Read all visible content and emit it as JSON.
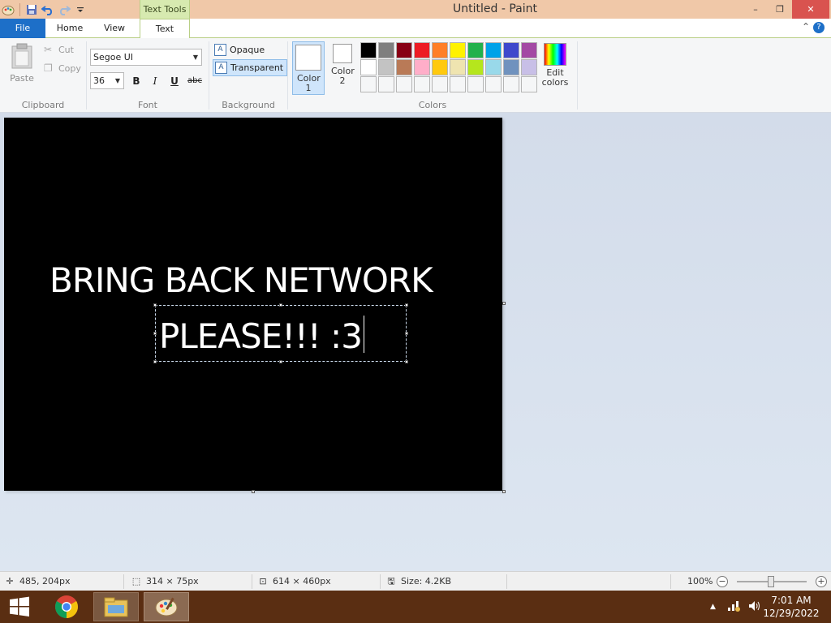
{
  "window": {
    "title": "Untitled - Paint",
    "context_tab": "Text Tools",
    "controls": {
      "minimize": "–",
      "restore": "❐",
      "close": "✕"
    }
  },
  "tabs": [
    {
      "label": "File"
    },
    {
      "label": "Home"
    },
    {
      "label": "View"
    },
    {
      "label": "Text"
    }
  ],
  "ribbon": {
    "clipboard": {
      "label": "Clipboard",
      "paste": "Paste",
      "cut": "Cut",
      "copy": "Copy"
    },
    "font": {
      "label": "Font",
      "family": "Segoe UI",
      "size": "36",
      "bold": "B",
      "italic": "I",
      "underline": "U",
      "strikethrough": "abc"
    },
    "background": {
      "label": "Background",
      "opaque": "Opaque",
      "transparent": "Transparent"
    },
    "colors": {
      "label": "Colors",
      "color1": "Color 1",
      "color2": "Color 2",
      "edit": "Edit colors",
      "color1_value": "#ffffff",
      "color2_value": "#ffffff",
      "palette": [
        "#000000",
        "#7f7f7f",
        "#880015",
        "#ed1c24",
        "#ff7f27",
        "#fff200",
        "#22b14c",
        "#00a2e8",
        "#3f48cc",
        "#a349a4",
        "#ffffff",
        "#c3c3c3",
        "#b97a57",
        "#ffaec9",
        "#ffc90e",
        "#efe4b0",
        "#b5e61d",
        "#99d9ea",
        "#7092be",
        "#c8bfe7",
        "#f5f6f7",
        "#f5f6f7",
        "#f5f6f7",
        "#f5f6f7",
        "#f5f6f7",
        "#f5f6f7",
        "#f5f6f7",
        "#f5f6f7",
        "#f5f6f7",
        "#f5f6f7"
      ]
    }
  },
  "canvas": {
    "line1": "BRING BACK NETWORK",
    "line2": "PLEASE!!! :3",
    "background": "#000000",
    "text_color": "#ffffff"
  },
  "statusbar": {
    "cursor_pos": "485, 204px",
    "selection_size": "314 × 75px",
    "image_size": "614 × 460px",
    "file_size": "Size: 4.2KB",
    "zoom": "100%"
  },
  "taskbar": {
    "apps": [
      "windows-start",
      "chrome",
      "file-explorer",
      "paint"
    ],
    "time": "7:01 AM",
    "date": "12/29/2022"
  }
}
